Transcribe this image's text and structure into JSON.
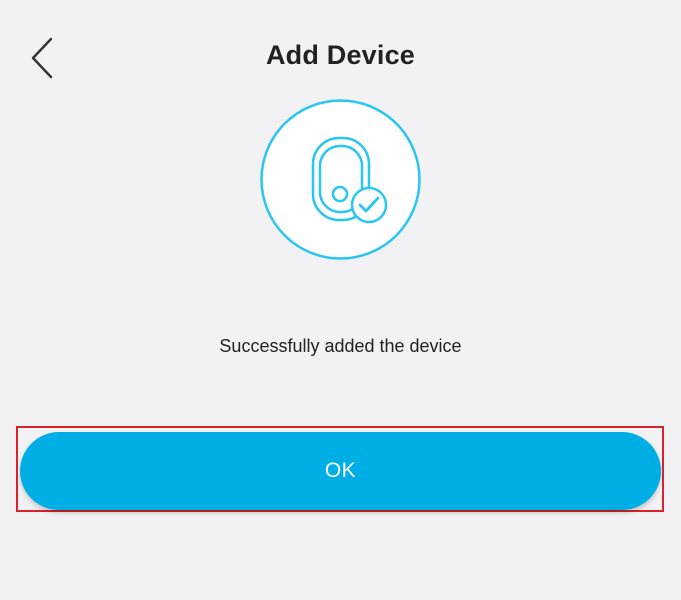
{
  "header": {
    "title": "Add Device",
    "back_icon": "chevron-left-icon"
  },
  "illustration": {
    "icon": "device-check-icon",
    "accent_color": "#29c6f2"
  },
  "message": "Successfully added the device",
  "ok_button": {
    "label": "OK",
    "color": "#00aee6",
    "highlight_color": "#d8232a"
  }
}
